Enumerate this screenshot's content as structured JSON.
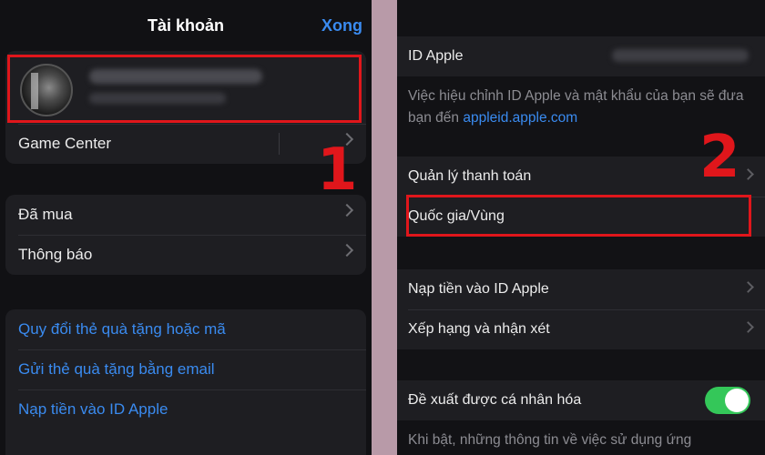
{
  "left": {
    "nav": {
      "title": "Tài khoản",
      "done": "Xong"
    },
    "game_center": "Game Center",
    "group2": [
      "Đã mua",
      "Thông báo"
    ],
    "links": [
      "Quy đổi thẻ quà tặng hoặc mã",
      "Gửi thẻ quà tặng bằng email",
      "Nạp tiền vào ID Apple"
    ],
    "step": "1"
  },
  "right": {
    "apple_id_label": "ID Apple",
    "note": {
      "text": "Việc hiệu chỉnh ID Apple và mật khẩu của bạn sẽ đưa bạn đến",
      "link": "appleid.apple.com"
    },
    "manage_payment": "Quản lý thanh toán",
    "country_region": "Quốc gia/Vùng",
    "add_funds": "Nạp tiền vào ID Apple",
    "ratings": "Xếp hạng và nhận xét",
    "personalized": "Đề xuất được cá nhân hóa",
    "personalized_on": true,
    "footer_note": "Khi bật, những thông tin về việc sử dụng ứng",
    "step": "2"
  },
  "colors": {
    "accent": "#3a8bf0",
    "highlight": "#e0161b",
    "toggle_on": "#34c759"
  }
}
